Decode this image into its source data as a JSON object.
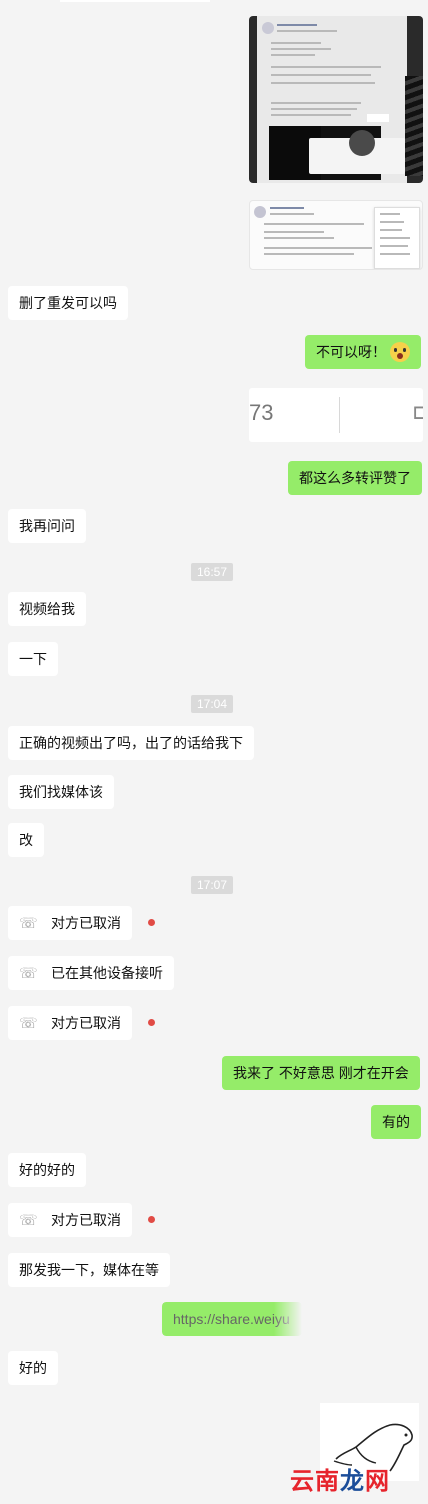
{
  "messages": {
    "m1": "删了重发可以吗",
    "m2": "不可以呀！",
    "m3": "都这么多转评赞了",
    "m4": "我再问问",
    "t1": "16:57",
    "m5": "视频给我",
    "m6": "一下",
    "t2": "17:04",
    "m7": "正确的视频出了吗，出了的话给我下",
    "m8": "我们找媒体该",
    "m9": "改",
    "t3": "17:07",
    "c1": "对方已取消",
    "c2": "已在其他设备接听",
    "c3": "对方已取消",
    "m10": "我来了 不好意思 刚才在开会",
    "m11": "有的",
    "m12": "好的好的",
    "c4": "对方已取消",
    "m13": "那发我一下，媒体在等",
    "m14": "https://share.weiyu",
    "m15": "好的"
  },
  "link_card": {
    "left_text": "73",
    "right_glyph": "⊏"
  },
  "watermark": "云南龙网",
  "colors": {
    "background": "#f4f4f4",
    "bubble_in": "#ffffff",
    "bubble_out": "#95ec69",
    "missed_dot": "#e14b45"
  },
  "icons": [
    "phone-icon",
    "scream-emoji-icon",
    "missed-dot"
  ]
}
